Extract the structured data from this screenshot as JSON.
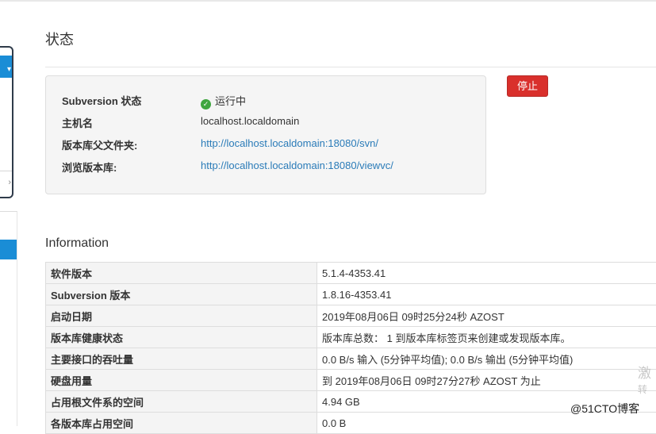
{
  "page": {
    "title": "状态"
  },
  "status": {
    "rows": [
      {
        "label": "Subversion 状态",
        "value": "运行中"
      },
      {
        "label": "主机名",
        "value": "localhost.localdomain"
      },
      {
        "label": "版本库父文件夹:",
        "value": "http://localhost.localdomain:18080/svn/"
      },
      {
        "label": "浏览版本库:",
        "value": "http://localhost.localdomain:18080/viewvc/"
      }
    ],
    "stop_label": "停止",
    "status_color": "#3fa63f"
  },
  "information": {
    "title": "Information",
    "rows": [
      {
        "key": "软件版本",
        "value": "5.1.4-4353.41"
      },
      {
        "key": "Subversion 版本",
        "value": "1.8.16-4353.41"
      },
      {
        "key": "启动日期",
        "value": "2019年08月06日 09时25分24秒 AZOST"
      },
      {
        "key": "版本库健康状态",
        "value": "版本库总数： 1 到版本库标签页来创建或发现版本库。"
      },
      {
        "key": "主要接口的吞吐量",
        "value": "0.0 B/s 输入 (5分钟平均值); 0.0 B/s 输出 (5分钟平均值)"
      },
      {
        "key": "硬盘用量",
        "value": "到 2019年08月06日 09时27分27秒 AZOST 为止"
      },
      {
        "key": "占用根文件系的空间",
        "value": "4.94 GB"
      },
      {
        "key": "各版本库占用空间",
        "value": "0.0 B"
      }
    ]
  },
  "watermark": {
    "line1": "激",
    "line2": "转",
    "brand": "@51CTO博客"
  },
  "colors": {
    "accent": "#1a8dd6",
    "danger": "#d9302c",
    "link": "#2a7bb8"
  }
}
